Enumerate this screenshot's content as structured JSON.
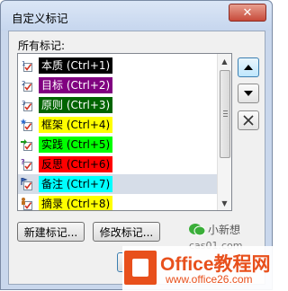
{
  "window": {
    "title": "自定义标记",
    "close_glyph": "✕"
  },
  "list": {
    "label": "所有标记:",
    "items": [
      {
        "label": "本质 (Ctrl+1)",
        "bg": "#000000",
        "fg": "#ffffff",
        "icon": "checkbox-1-icon"
      },
      {
        "label": "目标 (Ctrl+2)",
        "bg": "#800080",
        "fg": "#ffffff",
        "icon": "checkbox-2-icon"
      },
      {
        "label": "原则 (Ctrl+3)",
        "bg": "#006400",
        "fg": "#ffffff",
        "icon": "checkbox-3-icon"
      },
      {
        "label": "框架 (Ctrl+4)",
        "bg": "#ffff00",
        "fg": "#000000",
        "icon": "star-checkbox-icon"
      },
      {
        "label": "实践 (Ctrl+5)",
        "bg": "#00ff00",
        "fg": "#000000",
        "icon": "arrow-checkbox-icon"
      },
      {
        "label": "反思 (Ctrl+6)",
        "bg": "#ff0000",
        "fg": "#000000",
        "icon": "question-checkbox-icon"
      },
      {
        "label": "备注 (Ctrl+7)",
        "bg": "#00ffff",
        "fg": "#000000",
        "icon": "flag-checkbox-icon",
        "selected": true
      },
      {
        "label": "摘录 (Ctrl+8)",
        "bg": "#ffff00",
        "fg": "#000000",
        "icon": "person-checkbox-icon"
      }
    ]
  },
  "buttons": {
    "new_tag": "新建标记...",
    "modify_tag": "修改标记..."
  },
  "watermark": {
    "wechat_name": "小新想",
    "wechat_url": "cas01.com",
    "office_word": "Office教程网",
    "office_url": "www.office26.com"
  }
}
